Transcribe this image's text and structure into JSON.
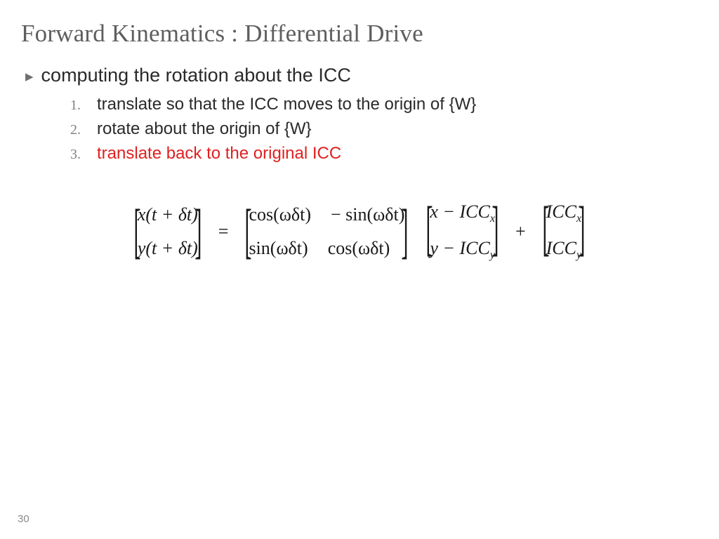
{
  "title": "Forward Kinematics : Differential Drive",
  "mainBullet": "computing the rotation about the ICC",
  "steps": {
    "s1": {
      "num": "1.",
      "text": "translate so that the ICC moves to the origin of {W}"
    },
    "s2": {
      "num": "2.",
      "text": "rotate about the origin of {W}"
    },
    "s3": {
      "num": "3.",
      "text": "translate back to the original ICC"
    }
  },
  "eq": {
    "lhs_r1": "x(t + δt)",
    "lhs_r2": "y(t + δt)",
    "rot_r1c1": "cos(ωδt)",
    "rot_r1c2": "− sin(ωδt)",
    "rot_r2c1": "sin(ωδt)",
    "rot_r2c2": "cos(ωδt)",
    "diff_r1_a": "x − ICC",
    "diff_r1_s": "x",
    "diff_r2_a": "y − ICC",
    "diff_r2_s": "y",
    "icc_r1_a": "ICC",
    "icc_r1_s": "x",
    "icc_r2_a": "ICC",
    "icc_r2_s": "y",
    "equals": "=",
    "plus": "+"
  },
  "pageNum": "30"
}
